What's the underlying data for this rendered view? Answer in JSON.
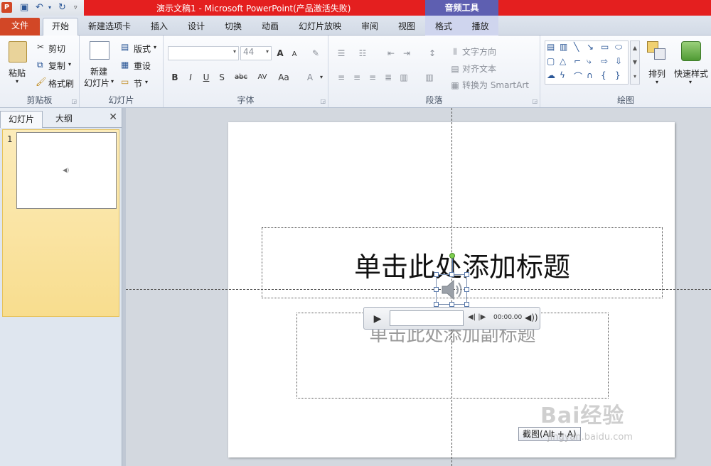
{
  "titlebar": {
    "app_icon": "P",
    "title": "演示文稿1 - Microsoft PowerPoint(产品激活失败)",
    "context_tab_group": "音频工具",
    "qat_icons": [
      "save-icon",
      "undo-icon",
      "redo-icon",
      "customize-qat-icon"
    ]
  },
  "tabs": {
    "file": "文件",
    "home": "开始",
    "new_tab": "新建选项卡",
    "insert": "插入",
    "design": "设计",
    "transitions": "切换",
    "animations": "动画",
    "slideshow": "幻灯片放映",
    "review": "审阅",
    "view": "视图",
    "format": "格式",
    "playback": "播放"
  },
  "ribbon": {
    "clipboard": {
      "label": "剪贴板",
      "paste": "粘贴",
      "cut": "剪切",
      "copy": "复制",
      "format_painter": "格式刷"
    },
    "slides": {
      "label": "幻灯片",
      "new_slide_line1": "新建",
      "new_slide_line2": "幻灯片",
      "layout": "版式",
      "reset": "重设",
      "section": "节"
    },
    "font": {
      "label": "字体",
      "font_name": "",
      "font_size": "44",
      "bold": "B",
      "italic": "I",
      "underline": "U",
      "shadow": "S",
      "strike": "abc",
      "spacing": "AV",
      "case": "Aa",
      "grow": "A",
      "shrink": "A",
      "color": "A"
    },
    "paragraph": {
      "label": "段落",
      "text_direction": "文字方向",
      "align_text": "对齐文本",
      "convert_smartart": "转换为 SmartArt"
    },
    "drawing": {
      "label": "绘图",
      "arrange": "排列",
      "quick_styles": "快速样式"
    }
  },
  "left_pane": {
    "tab_slides": "幻灯片",
    "tab_outline": "大纲",
    "close": "✕",
    "slide_number": "1"
  },
  "slide": {
    "title_placeholder": "单击此处添加标题",
    "subtitle_placeholder": "单击此处添加副标题"
  },
  "player": {
    "time": "00:00.00"
  },
  "tooltip": "截图(Alt + A)",
  "watermark": {
    "brand": "Bai经验",
    "url": "jingyan.baidu.com"
  },
  "colors": {
    "title_red": "#e41f1f",
    "file_tab": "#d24726",
    "context_header": "#5e5fb1",
    "selected_thumb": "#f8dd8e"
  }
}
